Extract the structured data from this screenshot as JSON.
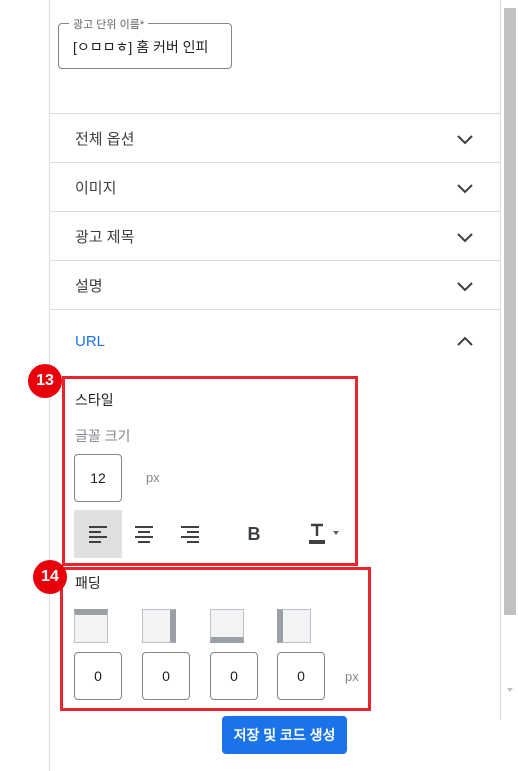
{
  "name_field": {
    "label": "광고 단위 이름*",
    "value": "[ㅇㅁㅁㅎ] 홈 커버 인피"
  },
  "accordion": {
    "items": [
      {
        "label": "전체 옵션",
        "expanded": false
      },
      {
        "label": "이미지",
        "expanded": false
      },
      {
        "label": "광고 제목",
        "expanded": false
      },
      {
        "label": "설명",
        "expanded": false
      },
      {
        "label": "URL",
        "expanded": true
      }
    ]
  },
  "style": {
    "title": "스타일",
    "font_size_label": "글꼴 크기",
    "font_size_value": "12",
    "font_size_unit": "px",
    "align_selected": "left",
    "bold_label": "B"
  },
  "padding": {
    "title": "패딩",
    "values": [
      "0",
      "0",
      "0",
      "0"
    ],
    "unit": "px"
  },
  "annotations": {
    "badge_13": "13",
    "badge_14": "14"
  },
  "save_button": "저장 및 코드 생성",
  "colors": {
    "accent": "#1a73e8",
    "annotation": "#e8252c"
  },
  "icons": [
    "chevron-down-icon",
    "chevron-up-icon",
    "align-left-icon",
    "align-center-icon",
    "align-right-icon",
    "bold-icon",
    "text-color-icon",
    "dropdown-arrow-icon",
    "padding-top-icon",
    "padding-right-icon",
    "padding-bottom-icon",
    "padding-left-icon"
  ]
}
